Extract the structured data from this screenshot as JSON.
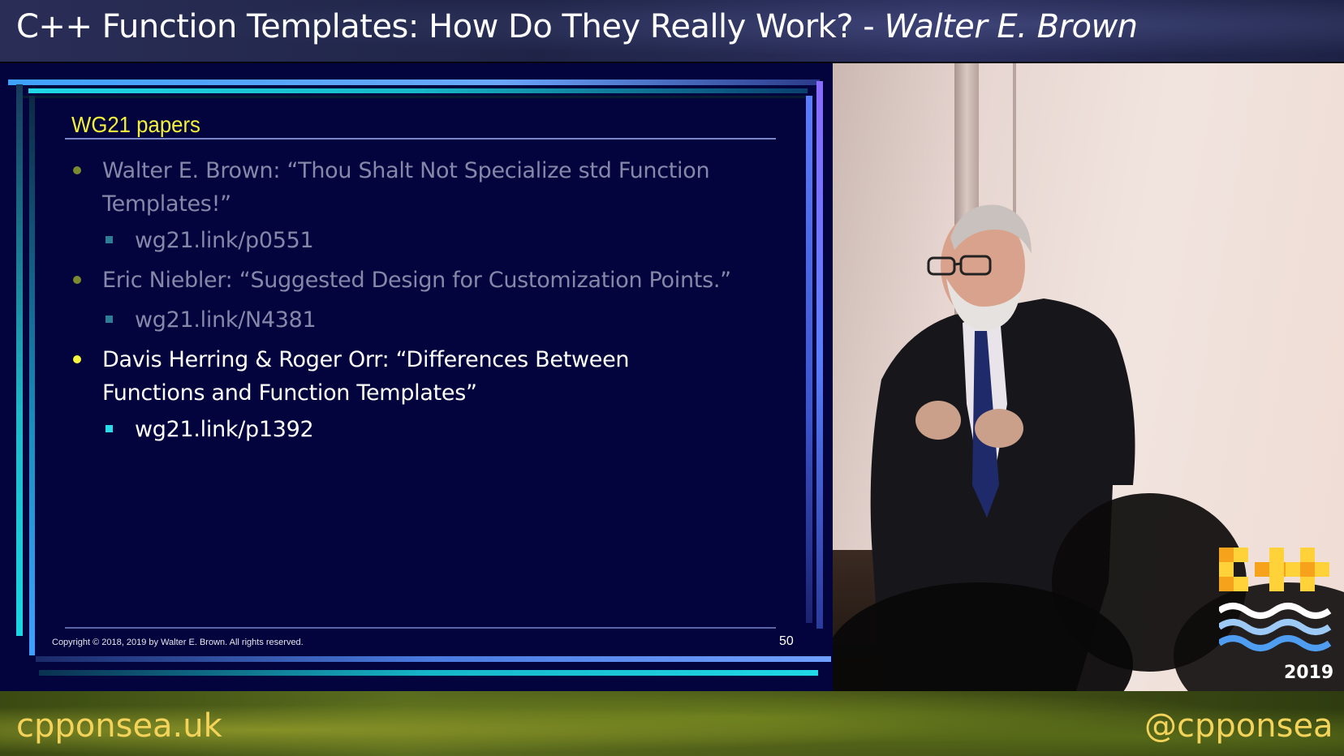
{
  "header": {
    "title": "C++ Function Templates: How Do They Really Work? - ",
    "speaker": "Walter E. Brown"
  },
  "slide": {
    "heading": "WG21 papers",
    "bullets": [
      {
        "line1": "Walter E. Brown:  “Thou Shalt Not Specialize std Function",
        "line2": "Templates!”",
        "link": "wg21.link/p0551",
        "state": "dim"
      },
      {
        "line1": "Eric Niebler:  “Suggested Design for Customization Points.”",
        "line2": "",
        "link": "wg21.link/N4381",
        "state": "dim"
      },
      {
        "line1": "Davis Herring & Roger Orr:  “Differences Between",
        "line2": "Functions and Function Templates”",
        "link": "wg21.link/p1392",
        "state": "active"
      }
    ],
    "copyright": "Copyright © 2018, 2019 by Walter E. Brown.  All rights reserved.",
    "page_number": "50"
  },
  "logo": {
    "year": "2019",
    "colors": {
      "orange": "#f7a21b",
      "yellow": "#ffd23a",
      "wave_blue": "#4f9df0"
    }
  },
  "footer": {
    "site": "cpponsea.uk",
    "handle": "@cpponsea"
  },
  "colors": {
    "slide_background": "#03033d",
    "heading": "#f3f03a",
    "footer_text": "#f4d35a"
  }
}
